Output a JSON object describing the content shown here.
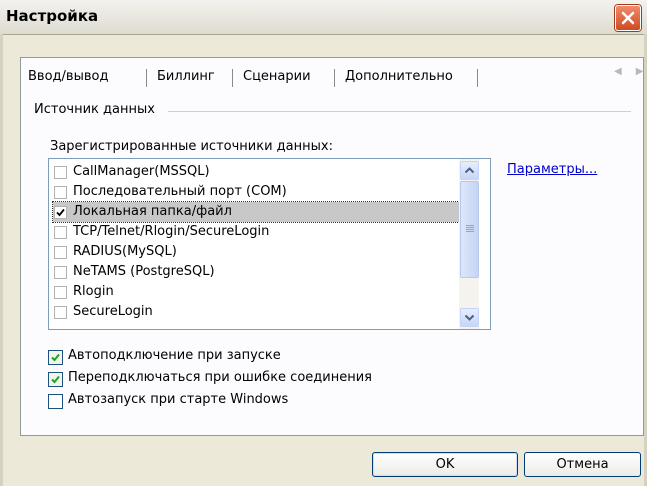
{
  "window": {
    "title": "Настройка",
    "close_label": "close"
  },
  "tabs": [
    "Ввод/вывод",
    "Биллинг",
    "Сценарии",
    "Дополнительно"
  ],
  "section": {
    "title": "Источник данных"
  },
  "datasources": {
    "label": "Зарегистрированные источники данных:",
    "items": [
      {
        "label": "CallManager(MSSQL)",
        "checked": false
      },
      {
        "label": "Последовательный порт (COM)",
        "checked": false
      },
      {
        "label": "Локальная папка/файл",
        "checked": true,
        "selected": true
      },
      {
        "label": "TCP/Telnet/Rlogin/SecureLogin",
        "checked": false
      },
      {
        "label": "RADIUS(MySQL)",
        "checked": false
      },
      {
        "label": "NeTAMS (PostgreSQL)",
        "checked": false
      },
      {
        "label": "Rlogin",
        "checked": false
      },
      {
        "label": "SecureLogin",
        "checked": false
      }
    ]
  },
  "params_link": "Параметры...",
  "options": [
    {
      "label": "Автоподключение при запуске",
      "checked": true
    },
    {
      "label": "Переподключаться при ошибке соединения",
      "checked": true
    },
    {
      "label": "Автозапуск при старте Windows",
      "checked": false
    }
  ],
  "buttons": {
    "ok": "OK",
    "cancel": "Отмена"
  },
  "colors": {
    "close_button": "#d04a22",
    "link": "#0000cc",
    "check": "#21a121"
  }
}
